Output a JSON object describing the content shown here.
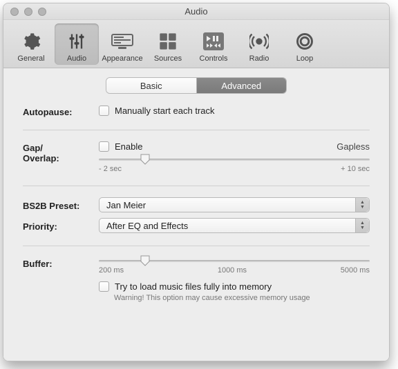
{
  "window": {
    "title": "Audio"
  },
  "toolbar": {
    "items": [
      {
        "label": "General"
      },
      {
        "label": "Audio"
      },
      {
        "label": "Appearance"
      },
      {
        "label": "Sources"
      },
      {
        "label": "Controls"
      },
      {
        "label": "Radio"
      },
      {
        "label": "Loop"
      }
    ]
  },
  "segmented": {
    "basic": "Basic",
    "advanced": "Advanced"
  },
  "autopause": {
    "label": "Autopause:",
    "option": "Manually start each track"
  },
  "gap": {
    "label": "Gap/\nOverlap:",
    "enable": "Enable",
    "gapless": "Gapless",
    "min": "- 2 sec",
    "max": "+ 10 sec"
  },
  "bs2b": {
    "label": "BS2B Preset:",
    "value": "Jan Meier"
  },
  "priority": {
    "label": "Priority:",
    "value": "After EQ and Effects"
  },
  "buffer": {
    "label": "Buffer:",
    "t1": "200 ms",
    "t2": "1000 ms",
    "t3": "5000 ms",
    "loadfully": "Try to load music files fully into memory",
    "warn": "Warning! This option may cause excessive memory usage"
  }
}
